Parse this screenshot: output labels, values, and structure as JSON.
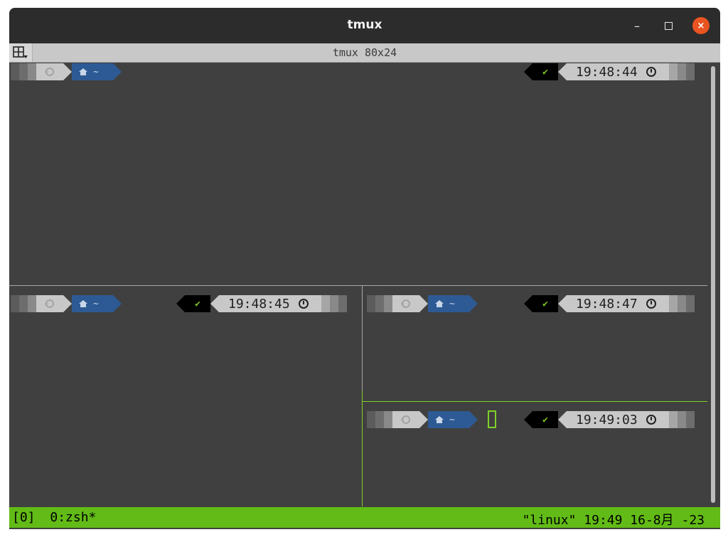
{
  "window": {
    "title": "tmux",
    "minimize_glyph": "–",
    "close_glyph": "×"
  },
  "tabbar": {
    "title": "tmux 80x24",
    "layout_icon": "layout-split-icon"
  },
  "prompt": {
    "distro_icon": "ubuntu-icon",
    "home_icon": "home-icon",
    "path": "~",
    "status_glyph": "✔",
    "clock_icon": "clock-icon"
  },
  "panes": [
    {
      "id": "pane-top",
      "time": "19:48:44"
    },
    {
      "id": "pane-bottom-left",
      "time": "19:48:45"
    },
    {
      "id": "pane-middle-right",
      "time": "19:48:47"
    },
    {
      "id": "pane-bottom-right",
      "time": "19:49:03",
      "active": true
    }
  ],
  "statusbar": {
    "session": "[0]",
    "window": "0:zsh*",
    "host_label": "\"linux\" 19:49 16-8月 -23"
  },
  "colors": {
    "status_green": "#62bb16",
    "active_border": "#7fd22a",
    "prompt_blue": "#2d5a94",
    "close_orange": "#e95420"
  }
}
